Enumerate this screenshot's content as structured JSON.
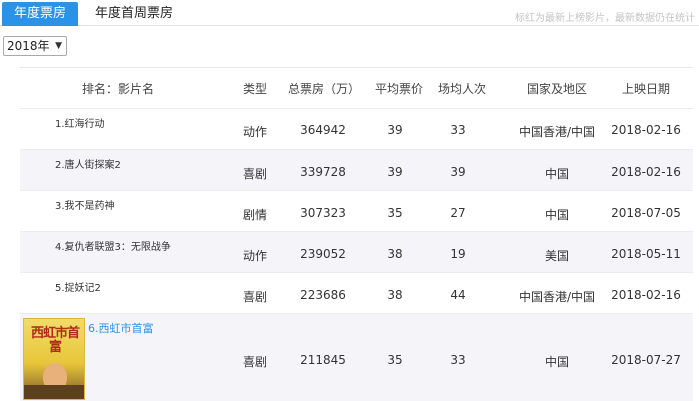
{
  "tabs": [
    {
      "label": "年度票房",
      "active": true
    },
    {
      "label": "年度首周票房",
      "active": false
    }
  ],
  "notice": "标红为最新上榜影片，最新数据仍在统计",
  "year_select": {
    "value": "2018年"
  },
  "table": {
    "headers": {
      "name": "排名：影片名",
      "type": "类型",
      "box": "总票房（万）",
      "avg_price": "平均票价",
      "avg_audience": "场均人次",
      "country": "国家及地区",
      "date": "上映日期"
    },
    "rows": [
      {
        "name": "1.红海行动",
        "type": "动作",
        "box": "364942",
        "avg_price": "39",
        "avg_audience": "33",
        "country": "中国香港/中国",
        "date": "2018-02-16"
      },
      {
        "name": "2.唐人街探案2",
        "type": "喜剧",
        "box": "339728",
        "avg_price": "39",
        "avg_audience": "39",
        "country": "中国",
        "date": "2018-02-16"
      },
      {
        "name": "3.我不是药神",
        "type": "剧情",
        "box": "307323",
        "avg_price": "35",
        "avg_audience": "27",
        "country": "中国",
        "date": "2018-07-05"
      },
      {
        "name": "4.复仇者联盟3：无限战争",
        "type": "动作",
        "box": "239052",
        "avg_price": "38",
        "avg_audience": "19",
        "country": "美国",
        "date": "2018-05-11"
      },
      {
        "name": "5.捉妖记2",
        "type": "喜剧",
        "box": "223686",
        "avg_price": "38",
        "avg_audience": "44",
        "country": "中国香港/中国",
        "date": "2018-02-16"
      },
      {
        "name": "6.西虹市首富",
        "type": "喜剧",
        "box": "211845",
        "avg_price": "35",
        "avg_audience": "33",
        "country": "中国",
        "date": "2018-07-27",
        "poster_title": "西虹市首富"
      }
    ]
  }
}
